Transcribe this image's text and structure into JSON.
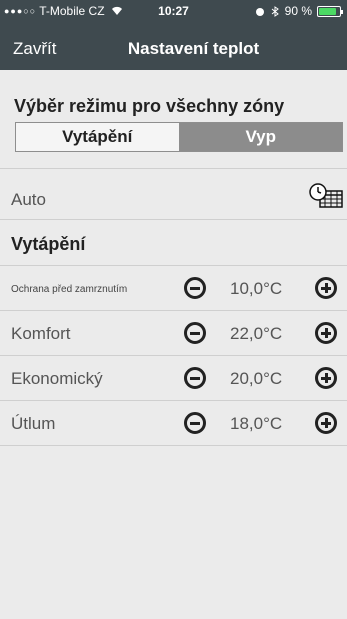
{
  "status_bar": {
    "signal_dots": "●●●○○",
    "carrier": "T-Mobile CZ",
    "time": "10:27",
    "battery_text": "90 %",
    "battery_color": "#4cd964"
  },
  "navbar": {
    "close_label": "Zavřít",
    "title": "Nastavení teplot"
  },
  "mode": {
    "label": "Výběr režimu pro všechny zóny",
    "options": [
      "Vytápění",
      "Vyp"
    ],
    "selected": "Vyp"
  },
  "auto": {
    "label": "Auto",
    "icon": "schedule-clock-icon"
  },
  "heating": {
    "header": "Vytápění",
    "rows": [
      {
        "label": "Ochrana před zamrznutím",
        "value": "10,0°C"
      },
      {
        "label": "Komfort",
        "value": "22,0°C"
      },
      {
        "label": "Ekonomický",
        "value": "20,0°C"
      },
      {
        "label": "Útlum",
        "value": "18,0°C"
      }
    ]
  },
  "colors": {
    "header_bg": "#3f4a4f",
    "background": "#ebebeb",
    "segment_selected": "#8c8c8c"
  }
}
